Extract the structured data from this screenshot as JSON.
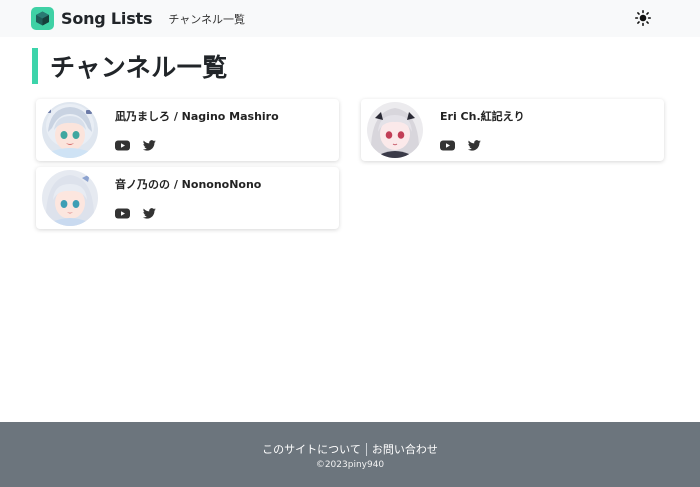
{
  "header": {
    "brand": "Song Lists",
    "nav_link": "チャンネル一覧",
    "theme_icon": "sun-icon"
  },
  "page": {
    "title": "チャンネル一覧"
  },
  "channels": [
    {
      "name": "凪乃ましろ / Nagino Mashiro",
      "links": [
        "youtube-icon",
        "twitter-icon"
      ]
    },
    {
      "name": "Eri Ch.紅記えり",
      "links": [
        "youtube-icon",
        "twitter-icon"
      ]
    },
    {
      "name": "音ノ乃のの / NononoNono",
      "links": [
        "youtube-icon",
        "twitter-icon"
      ]
    }
  ],
  "footer": {
    "about": "このサイトについて",
    "contact": "お問い合わせ",
    "copyright": "©2023piny940"
  },
  "colors": {
    "accent": "#3cd4aa",
    "navbar_bg": "#f8f9fa",
    "footer_bg": "#6c757d"
  }
}
